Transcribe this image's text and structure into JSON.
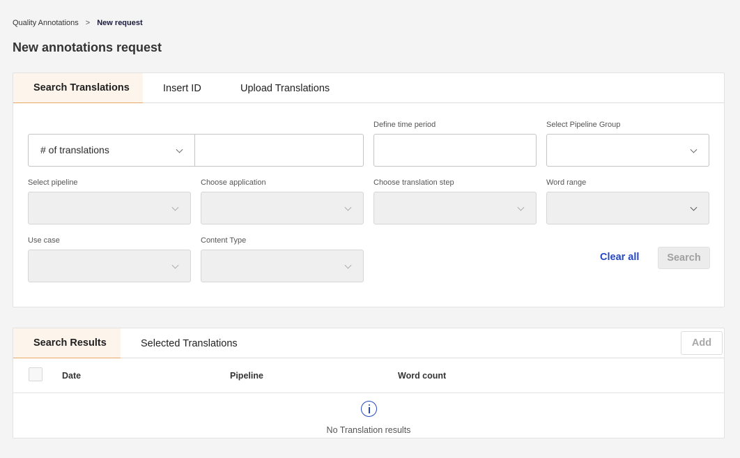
{
  "breadcrumb": {
    "parent": "Quality Annotations",
    "separator": ">",
    "current": "New request"
  },
  "page_title": "New annotations request",
  "search_card": {
    "tabs": [
      "Search Translations",
      "Insert ID",
      "Upload Translations"
    ],
    "active_tab": 0,
    "translations_select": {
      "value": "# of translations",
      "input_value": ""
    },
    "fields": {
      "time_period": {
        "label": "Define time period",
        "value": ""
      },
      "pipeline_group": {
        "label": "Select Pipeline Group",
        "value": ""
      },
      "pipeline": {
        "label": "Select pipeline",
        "value": ""
      },
      "application": {
        "label": "Choose application",
        "value": ""
      },
      "translation_step": {
        "label": "Choose translation step",
        "value": ""
      },
      "word_range": {
        "label": "Word range",
        "value": ""
      },
      "use_case": {
        "label": "Use case",
        "value": ""
      },
      "content_type": {
        "label": "Content Type",
        "value": ""
      }
    },
    "clear_label": "Clear all",
    "search_label": "Search"
  },
  "results_card": {
    "tabs": [
      "Search Results",
      "Selected Translations"
    ],
    "active_tab": 0,
    "add_label": "Add",
    "columns": [
      "Date",
      "Pipeline",
      "Word count"
    ],
    "rows": [],
    "empty_icon": "info-icon",
    "empty_text": "No Translation results"
  },
  "colors": {
    "accent_blue": "#2547c4",
    "tab_active_bg": "#fdf5ec",
    "tab_active_border": "#e8a765"
  }
}
